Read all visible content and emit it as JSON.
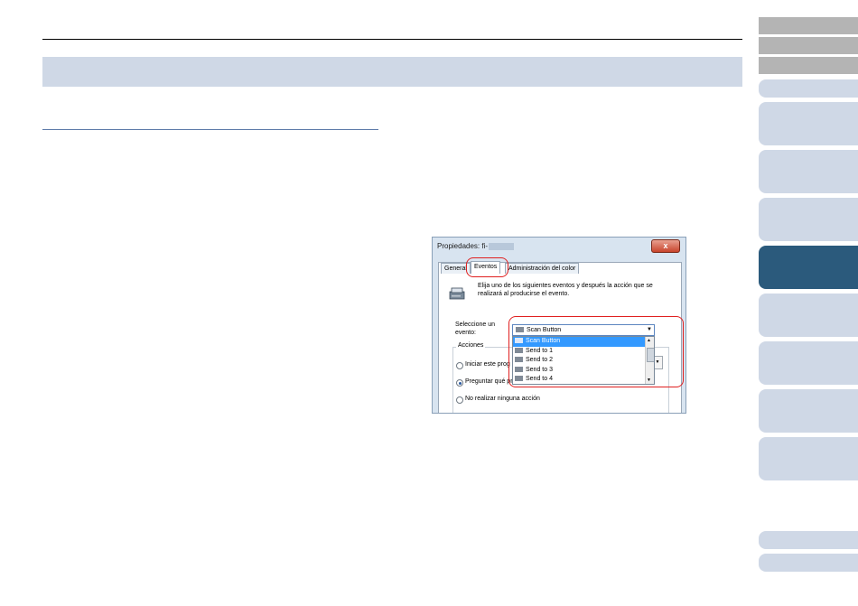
{
  "dialog": {
    "title": "Propiedades: fi-",
    "close": "x",
    "tabs": [
      "General",
      "Eventos",
      "Administración del color"
    ],
    "description": "Elija uno de los siguientes eventos y después la acción que se realizará al producirse el evento.",
    "event_label": "Seleccione un evento:",
    "selected_event": "Scan Button",
    "event_options": [
      "Scan Button",
      "Send to 1",
      "Send to 2",
      "Send to 3",
      "Send to 4"
    ],
    "actions_caption": "Acciones",
    "actions": [
      "Iniciar este prog",
      "Preguntar qué programa se desea ejecutar",
      "No realizar ninguna acción"
    ],
    "selected_action_index": 1
  },
  "icons": [
    "scanner-icon",
    "close-icon",
    "chevron-down-icon"
  ],
  "colors": {
    "band": "#cfd8e6",
    "active_tab": "#2b5a7c",
    "highlight": "#e02020",
    "selection": "#3399ff"
  }
}
